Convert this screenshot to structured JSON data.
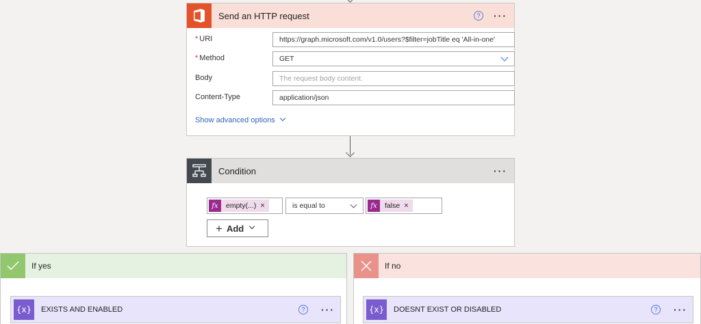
{
  "http_action": {
    "title": "Send an HTTP request",
    "help": "?",
    "more": "···",
    "fields": [
      {
        "label": "URI",
        "required": "*",
        "value": "https://graph.microsoft.com/v1.0/users?$filter=jobTitle eq 'All-in-one'"
      },
      {
        "label": "Method",
        "required": "*",
        "value": "GET"
      },
      {
        "label": "Body",
        "required": "",
        "placeholder": "The request body content."
      },
      {
        "label": "Content-Type",
        "required": "",
        "value": "application/json"
      }
    ],
    "advanced_link": "Show advanced options"
  },
  "condition": {
    "title": "Condition",
    "more": "···",
    "left_operand": {
      "fx": "fx",
      "label": "empty(...)",
      "remove": "×"
    },
    "operator": "is equal to",
    "right_operand": {
      "fx": "fx",
      "label": "false",
      "remove": "×"
    },
    "add_label": "Add",
    "add_plus": "+"
  },
  "branches": {
    "yes": {
      "title": "If yes",
      "action_title": "EXISTS AND ENABLED",
      "help": "?",
      "more": "···"
    },
    "no": {
      "title": "If no",
      "action_title": "DOESNT EXIST OR DISABLED",
      "help": "?",
      "more": "···"
    }
  },
  "icons": {
    "office": "office-icon",
    "condition": "condition-icon",
    "check": "check-icon",
    "cross": "cross-icon",
    "variable": "variable-icon"
  },
  "colors": {
    "http_accent": "#e3522a",
    "condition_accent": "#444950",
    "yes_accent": "#92c76e",
    "no_accent": "#e8928a",
    "variable_accent": "#7b5ccf",
    "link": "#2e63c0"
  }
}
